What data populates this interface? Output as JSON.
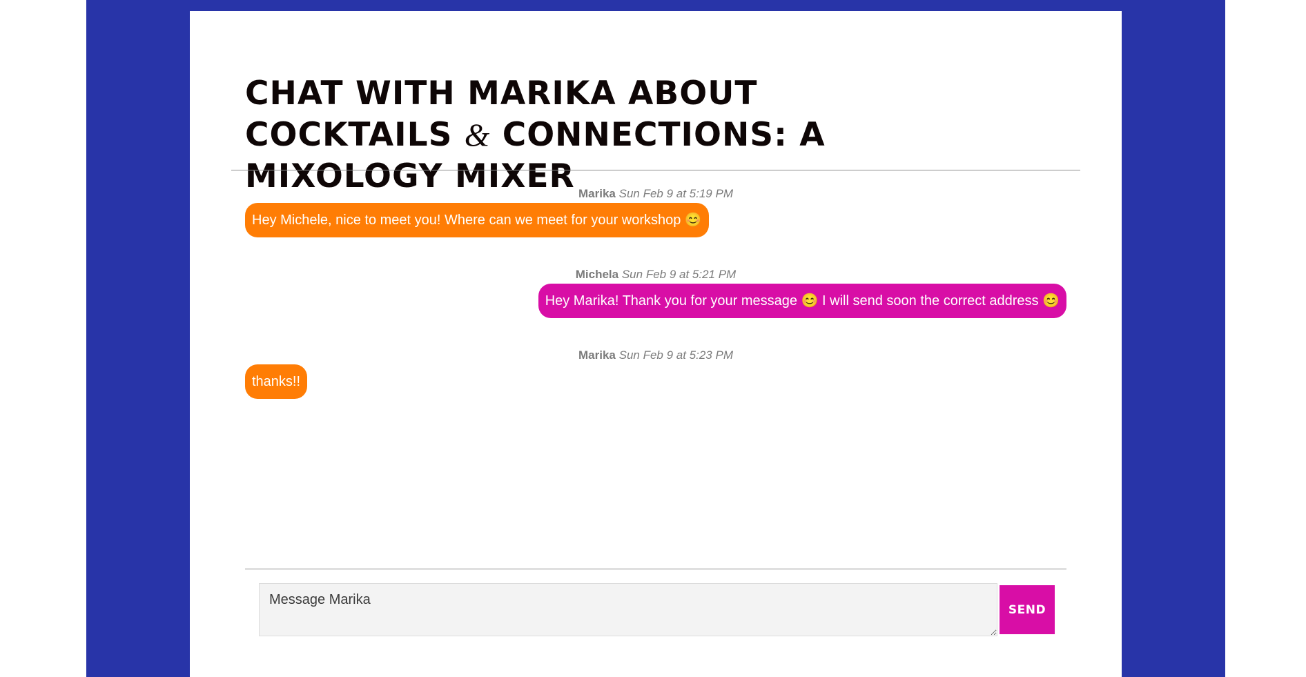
{
  "page": {
    "title_part1": "Chat with Marika about Cocktails ",
    "title_amp": "&",
    "title_part2": " Connections: A Mixology Mixer"
  },
  "colors": {
    "frame": "#2834a8",
    "incoming_bubble": "#ff7d05",
    "outgoing_bubble": "#d80ea6",
    "send_button": "#d80ea6"
  },
  "messages": [
    {
      "author": "Marika",
      "timestamp": "Sun Feb 9 at 5:19 PM",
      "text": "Hey Michele, nice to meet you! Where can we meet for your workshop 😊",
      "direction": "incoming"
    },
    {
      "author": "Michela",
      "timestamp": "Sun Feb 9 at 5:21 PM",
      "text": "Hey Marika! Thank you for your message 😊 I will send soon the correct address 😊",
      "direction": "outgoing"
    },
    {
      "author": "Marika",
      "timestamp": "Sun Feb 9 at 5:23 PM",
      "text": "thanks!!",
      "direction": "incoming"
    }
  ],
  "composer": {
    "placeholder": "Message Marika",
    "send_label": "Send"
  }
}
